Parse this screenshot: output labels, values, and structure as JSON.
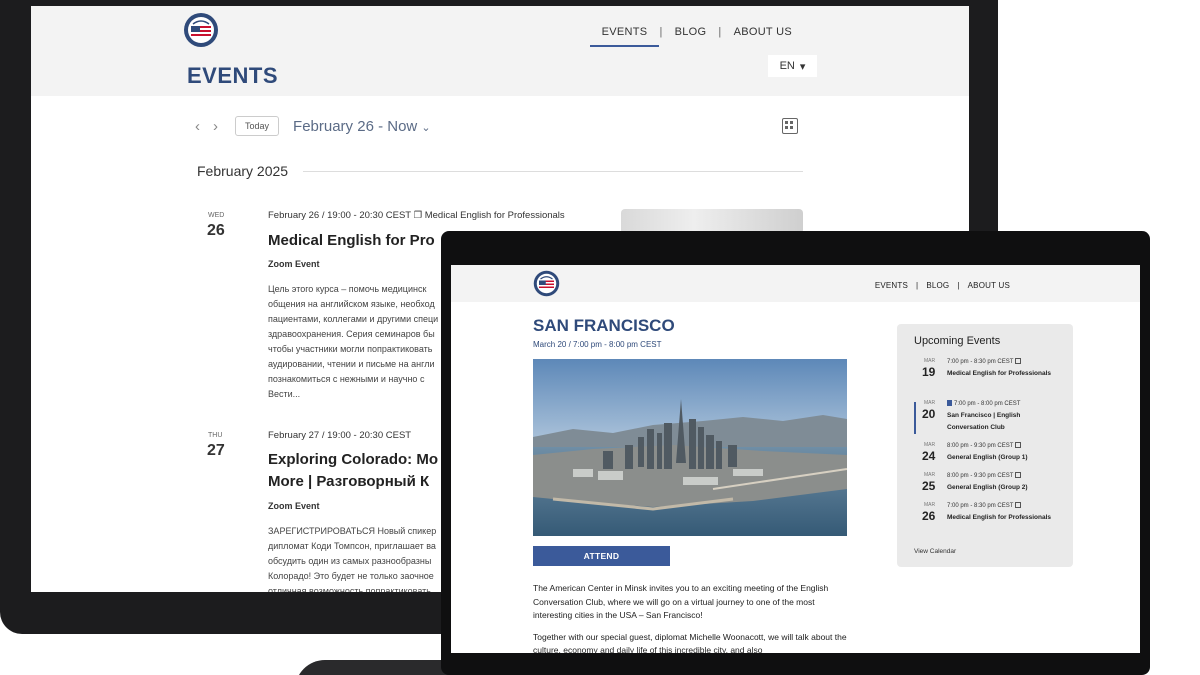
{
  "back_screen": {
    "nav": {
      "events": "EVENTS",
      "blog": "BLOG",
      "about": "ABOUT US",
      "sep": "|"
    },
    "page_title": "EVENTS",
    "lang": "EN",
    "toolbar": {
      "prev": "‹",
      "next": "›",
      "today": "Today",
      "range": "February 26 - Now"
    },
    "month_heading": "February 2025",
    "events": [
      {
        "dow": "WED",
        "day": "26",
        "meta": "February 26 / 19:00 - 20:30 CEST ❐ Medical English for Professionals",
        "title": "Medical English for Pro",
        "location": "Zoom Event",
        "desc": "Цель этого курса – помочь медицинск\nобщения на английском языке, необход\nпациентами, коллегами и другими специ\nздравоохранения. Серия семинаров бы\nчтобы участники могли попрактиковать\nаудировании, чтении и письме на англи\nпознакомиться с нежными и научно с\nВести..."
      },
      {
        "dow": "THU",
        "day": "27",
        "meta": "February 27 / 19:00 - 20:30 CEST",
        "title": "Exploring Colorado: Mo",
        "title2": "More | Разговорный К",
        "location": "Zoom Event",
        "desc": "ЗАРЕГИСТРИРОВАТЬСЯ Новый спикер\nдипломат Коди Томпсон, приглашает ва\nобсудить один из самых разнообразны\nКолорадо! Это будет не только заочное\nотличная возможность попрактиковать"
      }
    ]
  },
  "front_screen": {
    "nav": {
      "events": "EVENTS",
      "blog": "BLOG",
      "about": "ABOUT US",
      "sep": "|"
    },
    "title": "SAN FRANCISCO",
    "date": "March 20 / 7:00 pm - 8:00 pm CEST",
    "attend": "ATTEND",
    "body": [
      "The American Center in Minsk invites you to an exciting meeting of the English Conversation Club, where we will go on a virtual journey to one of the most interesting cities in the USA – San Francisco!",
      "Together with our special guest, diplomat Michelle Woonacott, we will talk about the culture, economy and daily life of this incredible city, and also"
    ],
    "upcoming": {
      "title": "Upcoming Events",
      "items": [
        {
          "mon": "MAR",
          "day": "19",
          "time": "7:00 pm - 8:30 pm CEST",
          "name": "Medical English for Professionals",
          "recurring": true,
          "featured": false
        },
        {
          "mon": "MAR",
          "day": "20",
          "time": "7:00 pm - 8:00 pm CEST",
          "name": "San Francisco | English Conversation Club",
          "recurring": false,
          "featured": true
        },
        {
          "mon": "MAR",
          "day": "24",
          "time": "8:00 pm - 9:30 pm CEST",
          "name": "General English (Group 1)",
          "recurring": true,
          "featured": false
        },
        {
          "mon": "MAR",
          "day": "25",
          "time": "8:00 pm - 9:30 pm CEST",
          "name": "General English (Group 2)",
          "recurring": true,
          "featured": false
        },
        {
          "mon": "MAR",
          "day": "26",
          "time": "7:00 pm - 8:30 pm CEST",
          "name": "Medical English for Professionals",
          "recurring": true,
          "featured": false
        }
      ],
      "view_calendar": "View Calendar"
    }
  },
  "colors": {
    "brand_blue": "#3b5a9a",
    "title_blue": "#2f4a7a",
    "header_gray": "#f3f3f3"
  },
  "icons": {
    "logo": "american-center-seal-icon",
    "view_toggle": "grid-list-icon",
    "recurring": "recurring-icon",
    "featured": "bookmark-icon"
  }
}
